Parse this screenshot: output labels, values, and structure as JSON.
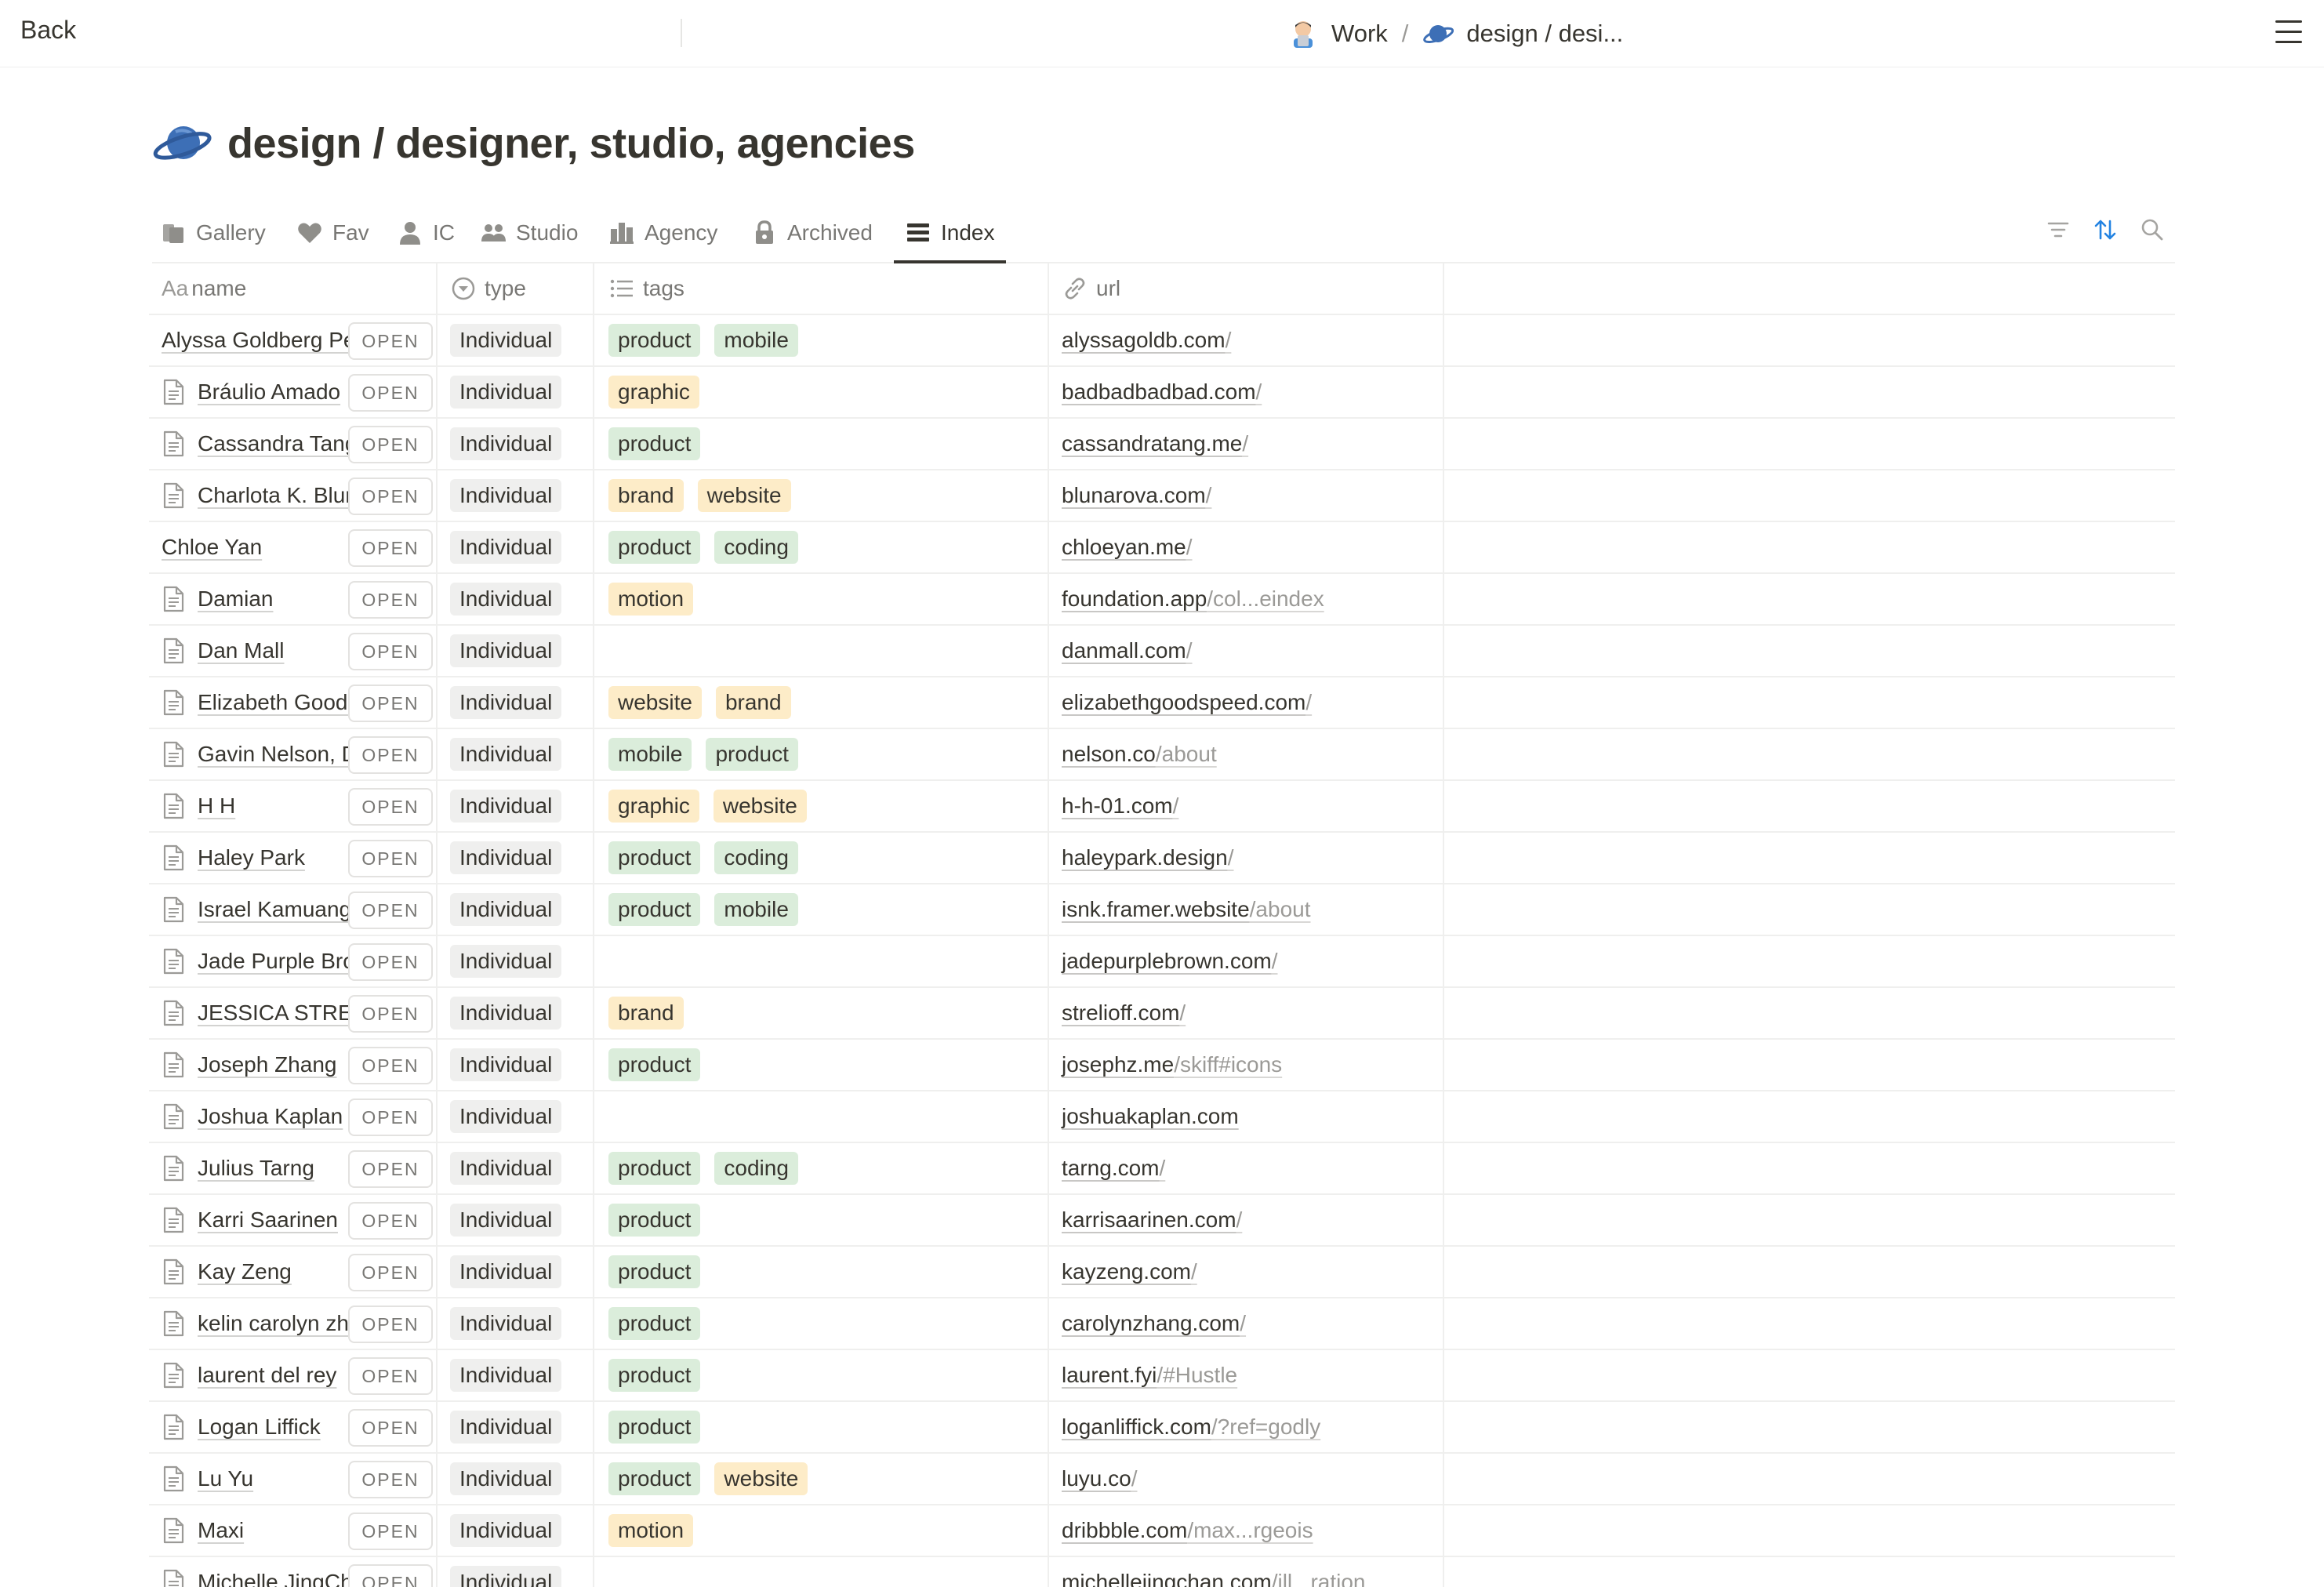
{
  "topbar": {
    "back_label": "Back",
    "crumbs": [
      {
        "label": "Work",
        "icon": "man-technologist-icon"
      },
      {
        "label": "design / desi...",
        "icon": "planet-icon"
      }
    ],
    "separator": "/"
  },
  "page": {
    "title": "design / designer, studio, agencies",
    "title_icon": "ringed-planet-icon"
  },
  "tabs": [
    {
      "label": "Gallery",
      "icon": "gallery-icon"
    },
    {
      "label": "Fav",
      "icon": "heart-icon"
    },
    {
      "label": "IC",
      "icon": "person-icon"
    },
    {
      "label": "Studio",
      "icon": "people-icon"
    },
    {
      "label": "Agency",
      "icon": "building-icon"
    },
    {
      "label": "Archived",
      "icon": "lock-icon"
    },
    {
      "label": "Index",
      "icon": "list-icon",
      "active": true
    }
  ],
  "tools": [
    "filter-icon",
    "sort-icon",
    "search-icon"
  ],
  "columns": {
    "name": {
      "prefix": "Aa",
      "label": "name"
    },
    "type": {
      "label": "type"
    },
    "tags": {
      "label": "tags"
    },
    "url": {
      "label": "url"
    }
  },
  "open_label": "OPEN",
  "colors": {
    "tag_green": "#dbeddb",
    "tag_yellow": "#fdecc8",
    "tag_gray": "#efefee",
    "accent_blue": "#2383e2"
  },
  "rows": [
    {
      "name": "Alyssa Goldberg Pe",
      "doc": false,
      "type": "Individual",
      "tags": [
        {
          "label": "product",
          "color": "green"
        },
        {
          "label": "mobile",
          "color": "green"
        }
      ],
      "url": "alyssagoldb.com",
      "url_rest": "/"
    },
    {
      "name": "Bráulio Amado",
      "doc": true,
      "type": "Individual",
      "tags": [
        {
          "label": "graphic",
          "color": "yellow"
        }
      ],
      "url": "badbadbadbad.com",
      "url_rest": "/"
    },
    {
      "name": "Cassandra Tang",
      "doc": true,
      "type": "Individual",
      "tags": [
        {
          "label": "product",
          "color": "green"
        }
      ],
      "url": "cassandratang.me",
      "url_rest": "/"
    },
    {
      "name": "Charlota K. Blun",
      "doc": true,
      "type": "Individual",
      "tags": [
        {
          "label": "brand",
          "color": "yellow"
        },
        {
          "label": "website",
          "color": "yellow"
        }
      ],
      "url": "blunarova.com",
      "url_rest": "/"
    },
    {
      "name": "Chloe Yan",
      "doc": false,
      "type": "Individual",
      "tags": [
        {
          "label": "product",
          "color": "green"
        },
        {
          "label": "coding",
          "color": "green"
        }
      ],
      "url": "chloeyan.me",
      "url_rest": "/"
    },
    {
      "name": "Damian",
      "doc": true,
      "type": "Individual",
      "tags": [
        {
          "label": "motion",
          "color": "yellow"
        }
      ],
      "url": "foundation.app",
      "url_rest": "/col...eindex"
    },
    {
      "name": "Dan Mall",
      "doc": true,
      "type": "Individual",
      "tags": [],
      "url": "danmall.com",
      "url_rest": "/"
    },
    {
      "name": "Elizabeth Goods",
      "doc": true,
      "type": "Individual",
      "tags": [
        {
          "label": "website",
          "color": "yellow"
        },
        {
          "label": "brand",
          "color": "yellow"
        }
      ],
      "url": "elizabethgoodspeed.com",
      "url_rest": "/"
    },
    {
      "name": "Gavin Nelson, D",
      "doc": true,
      "type": "Individual",
      "tags": [
        {
          "label": "mobile",
          "color": "green"
        },
        {
          "label": "product",
          "color": "green"
        }
      ],
      "url": "nelson.co",
      "url_rest": "/about"
    },
    {
      "name": "H H",
      "doc": true,
      "type": "Individual",
      "tags": [
        {
          "label": "graphic",
          "color": "yellow"
        },
        {
          "label": "website",
          "color": "yellow"
        }
      ],
      "url": "h-h-01.com",
      "url_rest": "/"
    },
    {
      "name": "Haley Park",
      "doc": true,
      "type": "Individual",
      "tags": [
        {
          "label": "product",
          "color": "green"
        },
        {
          "label": "coding",
          "color": "green"
        }
      ],
      "url": "haleypark.design",
      "url_rest": "/"
    },
    {
      "name": "Israel Kamuang",
      "doc": true,
      "type": "Individual",
      "tags": [
        {
          "label": "product",
          "color": "green"
        },
        {
          "label": "mobile",
          "color": "green"
        }
      ],
      "url": "isnk.framer.website",
      "url_rest": "/about"
    },
    {
      "name": "Jade Purple Bro",
      "doc": true,
      "type": "Individual",
      "tags": [],
      "url": "jadepurplebrown.com",
      "url_rest": "/"
    },
    {
      "name": "JESSICA STREL",
      "doc": true,
      "type": "Individual",
      "tags": [
        {
          "label": "brand",
          "color": "yellow"
        }
      ],
      "url": "strelioff.com",
      "url_rest": "/"
    },
    {
      "name": "Joseph Zhang",
      "doc": true,
      "type": "Individual",
      "tags": [
        {
          "label": "product",
          "color": "green"
        }
      ],
      "url": "josephz.me",
      "url_rest": "/skiff#icons"
    },
    {
      "name": "Joshua Kaplan",
      "doc": true,
      "type": "Individual",
      "tags": [],
      "url": "joshuakaplan.com",
      "url_rest": ""
    },
    {
      "name": "Julius Tarng",
      "doc": true,
      "type": "Individual",
      "tags": [
        {
          "label": "product",
          "color": "green"
        },
        {
          "label": "coding",
          "color": "green"
        }
      ],
      "url": "tarng.com",
      "url_rest": "/"
    },
    {
      "name": "Karri Saarinen",
      "doc": true,
      "type": "Individual",
      "tags": [
        {
          "label": "product",
          "color": "green"
        }
      ],
      "url": "karrisaarinen.com",
      "url_rest": "/"
    },
    {
      "name": "Kay Zeng",
      "doc": true,
      "type": "Individual",
      "tags": [
        {
          "label": "product",
          "color": "green"
        }
      ],
      "url": "kayzeng.com",
      "url_rest": "/"
    },
    {
      "name": "kelin carolyn zh",
      "doc": true,
      "type": "Individual",
      "tags": [
        {
          "label": "product",
          "color": "green"
        }
      ],
      "url": "carolynzhang.com",
      "url_rest": "/"
    },
    {
      "name": "laurent del rey",
      "doc": true,
      "type": "Individual",
      "tags": [
        {
          "label": "product",
          "color": "green"
        }
      ],
      "url": "laurent.fyi",
      "url_rest": "/#Hustle"
    },
    {
      "name": "Logan Liffick",
      "doc": true,
      "type": "Individual",
      "tags": [
        {
          "label": "product",
          "color": "green"
        }
      ],
      "url": "loganliffick.com",
      "url_rest": "/?ref=godly"
    },
    {
      "name": "Lu Yu",
      "doc": true,
      "type": "Individual",
      "tags": [
        {
          "label": "product",
          "color": "green"
        },
        {
          "label": "website",
          "color": "yellow"
        }
      ],
      "url": "luyu.co",
      "url_rest": "/"
    },
    {
      "name": "Maxi",
      "doc": true,
      "type": "Individual",
      "tags": [
        {
          "label": "motion",
          "color": "yellow"
        }
      ],
      "url": "dribbble.com",
      "url_rest": "/max...rgeois"
    },
    {
      "name": "Michelle JingCh",
      "doc": true,
      "type": "Individual",
      "tags": [],
      "url": "michellejingchan.com",
      "url_rest": "/ill...ration"
    }
  ]
}
